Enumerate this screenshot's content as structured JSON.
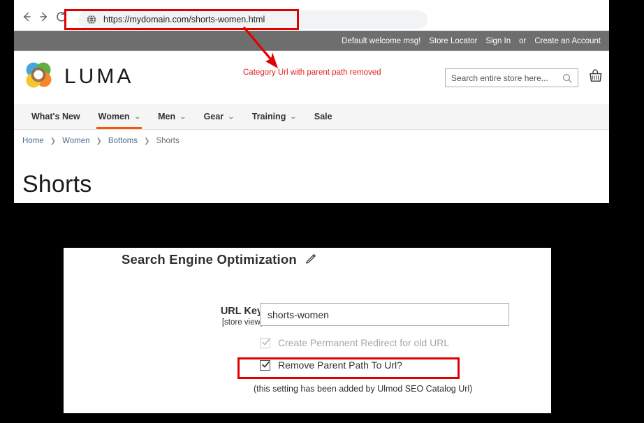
{
  "browser": {
    "back_icon": "back-arrow-icon",
    "forward_icon": "forward-arrow-icon",
    "reload_icon": "reload-icon",
    "site_info_icon": "globe-icon",
    "url": "https://mydomain.com/shorts-women.html"
  },
  "annotations": {
    "url_note": "Category Url with parent path removed",
    "highlight_color": "#e00000",
    "arrow_icon": "red-arrow-icon"
  },
  "storefront": {
    "topbar": {
      "welcome": "Default welcome msg!",
      "store_locator": "Store Locator",
      "sign_in": "Sign In",
      "or": "or",
      "create_account": "Create an Account"
    },
    "logo": {
      "wordmark": "LUMA",
      "icon": "luma-flower-logo-icon",
      "colors": [
        "#3aa4dc",
        "#5aaa3c",
        "#f58220",
        "#f6c221",
        "#8b6340"
      ]
    },
    "search": {
      "placeholder": "Search entire store here...",
      "value": "",
      "icon": "search-icon"
    },
    "cart_icon": "shopping-cart-icon",
    "nav": [
      {
        "label": "What's New",
        "caret": "",
        "active": false
      },
      {
        "label": "Women",
        "caret": "⌄",
        "active": true
      },
      {
        "label": "Men",
        "caret": "⌄",
        "active": false
      },
      {
        "label": "Gear",
        "caret": "⌄",
        "active": false
      },
      {
        "label": "Training",
        "caret": "⌄",
        "active": false
      },
      {
        "label": "Sale",
        "caret": "",
        "active": false
      }
    ],
    "nav_active_color": "#ff5501",
    "breadcrumb": {
      "items": [
        "Home",
        "Women",
        "Bottoms"
      ],
      "current": "Shorts",
      "separator": "❯"
    },
    "page_title": "Shorts"
  },
  "admin": {
    "section_title": "Search Engine Optimization",
    "edit_icon": "pencil-edit-icon",
    "url_key": {
      "label": "URL Key",
      "scope": "[store view]",
      "value": "shorts-women"
    },
    "checkboxes": [
      {
        "label": "Create Permanent Redirect for old URL",
        "checked": true,
        "disabled": true,
        "icon": "checkbox-checked-icon"
      },
      {
        "label": "Remove Parent Path To Url?",
        "checked": true,
        "disabled": false,
        "icon": "checkbox-checked-icon"
      }
    ],
    "note": "(this setting has been added by Ulmod SEO Catalog Url)"
  }
}
